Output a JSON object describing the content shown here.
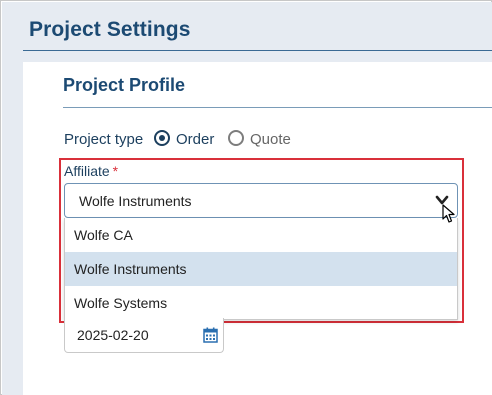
{
  "header": {
    "title": "Project Settings"
  },
  "profile": {
    "title": "Project Profile",
    "project_type": {
      "label": "Project type",
      "options": [
        {
          "label": "Order",
          "selected": true
        },
        {
          "label": "Quote",
          "selected": false
        }
      ]
    },
    "affiliate": {
      "label": "Affiliate",
      "required_mark": "*",
      "value": "Wolfe Instruments",
      "options": [
        "Wolfe CA",
        "Wolfe Instruments",
        "Wolfe Systems"
      ],
      "selected_index": 1
    },
    "date": {
      "value": "2025-02-20"
    }
  },
  "colors": {
    "accent": "#1c4a73",
    "highlight_border": "#d9303a",
    "selected_option_bg": "#d3e1ee",
    "header_bg": "#e6ebf2"
  },
  "icons": [
    "chevron-down-icon",
    "calendar-icon",
    "mouse-cursor-icon"
  ]
}
